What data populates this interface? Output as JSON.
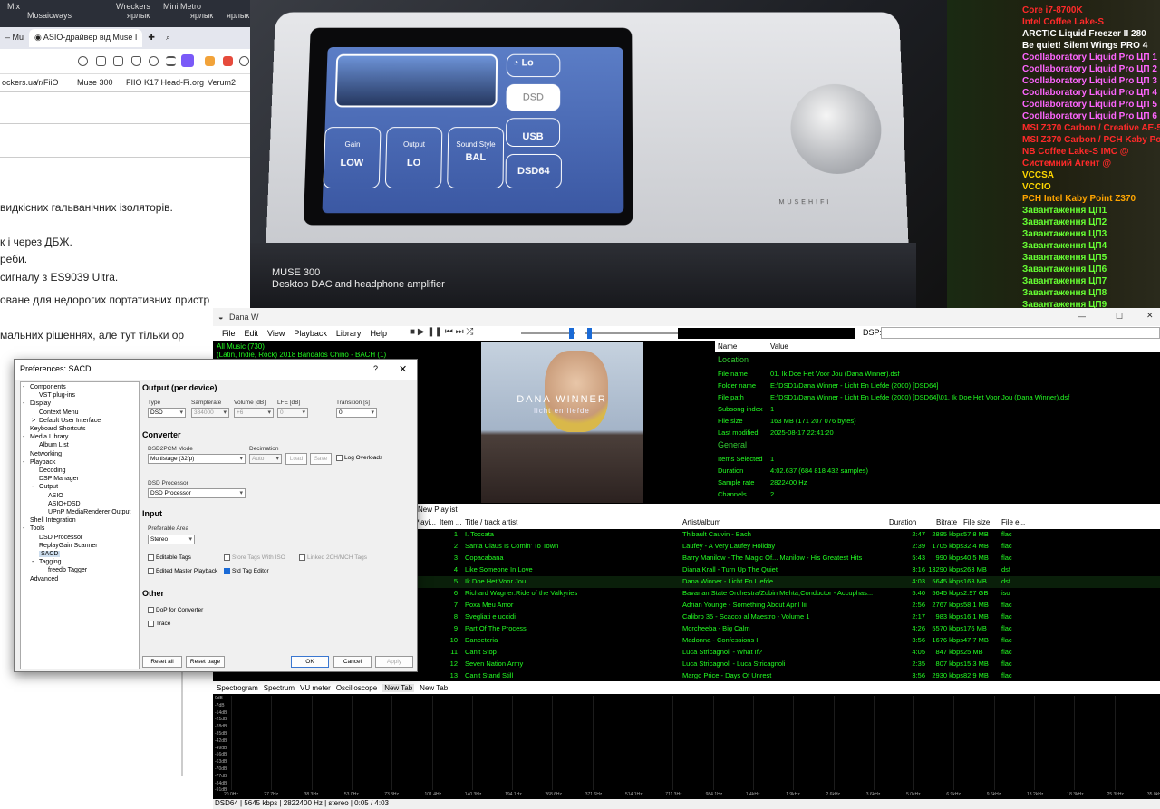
{
  "browser": {
    "desktop_labels": [
      "Mix",
      "Mosaicways",
      "ярлык",
      "Wreckers",
      "Mini Metro",
      "ярлык",
      "ярлык"
    ],
    "tabs": [
      {
        "label": "– Mu"
      },
      {
        "label": "ASIO-драйвер від Muse I"
      }
    ],
    "bookmarks": [
      "ockers.ua",
      "/r/FiiO",
      "Muse 300",
      "FIIO K17 Head-Fi.org",
      "Verum2"
    ],
    "article_lines": [
      "видкісних гальванічних ізоляторів.",
      "к і через ДБЖ.",
      "реби.",
      " сигналу з ES9039 Ultra.",
      "оване для недорогих портативних пристр",
      "мальних рішеннях, але тут тільки ор"
    ]
  },
  "photo": {
    "title": "MUSE 300",
    "subtitle": "Desktop DAC and headphone amplifier",
    "device": {
      "volume_label": "Lo",
      "dsd_label": "DSD",
      "usb_label": "USB",
      "dsd64_label": "DSD64",
      "gain_label": "Gain",
      "gain_value": "LOW",
      "output_label": "Output",
      "output_value": "LO",
      "sound_label": "Sound Style",
      "sound_value": "BAL",
      "brand": "MUSEHIFI"
    }
  },
  "osd": {
    "lines": [
      {
        "text": "Core i7-8700K",
        "color": "#ff2a2a"
      },
      {
        "text": "Intel Coffee Lake-S",
        "color": "#ff2a2a"
      },
      {
        "text": "ARCTIC Liquid Freezer II 280",
        "color": "#ffffff"
      },
      {
        "text": "Be quiet! Silent Wings PRO 4",
        "color": "#ffffff"
      },
      {
        "text": "Coollaboratory Liquid Pro ЦП 1",
        "color": "#ff66ff"
      },
      {
        "text": "Coollaboratory Liquid Pro ЦП 2",
        "color": "#ff66ff"
      },
      {
        "text": "Coollaboratory Liquid Pro ЦП 3",
        "color": "#ff66ff"
      },
      {
        "text": "Coollaboratory Liquid Pro ЦП 4",
        "color": "#ff66ff"
      },
      {
        "text": "Coollaboratory Liquid Pro ЦП 5",
        "color": "#ff66ff"
      },
      {
        "text": "Coollaboratory Liquid Pro ЦП 6",
        "color": "#ff66ff"
      },
      {
        "text": "MSI Z370 Carbon / Creative AE-5",
        "color": "#ff2a2a"
      },
      {
        "text": "MSI Z370 Carbon / PCH Kaby Point",
        "color": "#ff2a2a"
      },
      {
        "text": "NB Coffee Lake-S IMC @",
        "color": "#ff2a2a"
      },
      {
        "text": "Системний Агент @",
        "color": "#ff2a2a"
      },
      {
        "text": "VCCSA",
        "color": "#ffd700"
      },
      {
        "text": "VCCIO",
        "color": "#ffd700"
      },
      {
        "text": "PCH Intel Kaby Point Z370",
        "color": "#ffa500"
      },
      {
        "text": "Завантаження ЦП1",
        "color": "#66ff33"
      },
      {
        "text": "Завантаження ЦП2",
        "color": "#66ff33"
      },
      {
        "text": "Завантаження ЦП3",
        "color": "#66ff33"
      },
      {
        "text": "Завантаження ЦП4",
        "color": "#66ff33"
      },
      {
        "text": "Завантаження ЦП5",
        "color": "#66ff33"
      },
      {
        "text": "Завантаження ЦП6",
        "color": "#66ff33"
      },
      {
        "text": "Завантаження ЦП7",
        "color": "#66ff33"
      },
      {
        "text": "Завантаження ЦП8",
        "color": "#66ff33"
      },
      {
        "text": "Завантаження ЦП9",
        "color": "#66ff33"
      }
    ]
  },
  "foobar": {
    "title": "Dana W",
    "menu": [
      "File",
      "Edit",
      "View",
      "Playback",
      "Library",
      "Help"
    ],
    "dsp_label": "DSP:",
    "library": [
      "All Music (730)",
      "(Latin, Indie, Rock) 2018 Bandalos Chino - BACH (1)"
    ],
    "art": {
      "line1": "DANA WINNER",
      "line2": "licht en liefde"
    },
    "props_headers": {
      "name": "Name",
      "value": "Value"
    },
    "props_location_title": "Location",
    "props_location": [
      {
        "k": "File name",
        "v": "01. Ik Doe Het Voor Jou (Dana Winner).dsf"
      },
      {
        "k": "Folder name",
        "v": "E:\\DSD1\\Dana Winner - Licht En Liefde (2000) [DSD64]"
      },
      {
        "k": "File path",
        "v": "E:\\DSD1\\Dana Winner - Licht En Liefde (2000) [DSD64]\\01. Ik Doe Het Voor Jou (Dana Winner).dsf"
      },
      {
        "k": "Subsong index",
        "v": "1"
      },
      {
        "k": "File size",
        "v": "163 MB (171 207 076 bytes)"
      },
      {
        "k": "Last modified",
        "v": "2025-08-17 22:41:20"
      }
    ],
    "props_general_title": "General",
    "props_general": [
      {
        "k": "Items Selected",
        "v": "1"
      },
      {
        "k": "Duration",
        "v": "4:02.637 (684 818 432 samples)"
      },
      {
        "k": "Sample rate",
        "v": "2822400 Hz"
      },
      {
        "k": "Channels",
        "v": "2"
      }
    ],
    "playlist_tab": "New Playlist",
    "playlist_headers": {
      "playing": "Playi...",
      "item": "Item ...",
      "title": "Title / track artist",
      "artist": "Artist/album",
      "duration": "Duration",
      "bitrate": "Bitrate",
      "size": "File size",
      "ext": "File e..."
    },
    "playlist": [
      {
        "n": "1",
        "title": "I. Toccata",
        "artist": "Thibault Cauvin - Bach",
        "dur": "2:47",
        "br": "2885 kbps",
        "size": "57.8 MB",
        "ext": "flac"
      },
      {
        "n": "2",
        "title": "Santa Claus Is Comin' To Town",
        "artist": "Laufey - A Very Laufey Holiday",
        "dur": "2:39",
        "br": "1705 kbps",
        "size": "32.4 MB",
        "ext": "flac"
      },
      {
        "n": "3",
        "title": "Copacabana",
        "artist": "Barry Manilow - The Magic Of... Manilow -  His Greatest Hits",
        "dur": "5:43",
        "br": "990 kbps",
        "size": "40.5 MB",
        "ext": "flac"
      },
      {
        "n": "4",
        "title": "Like Someone In Love",
        "artist": "Diana Krall - Turn Up The Quiet",
        "dur": "3:16",
        "br": "13290 kbps",
        "size": "263 MB",
        "ext": "dsf"
      },
      {
        "n": "5",
        "title": "Ik Doe Het Voor Jou",
        "artist": "Dana Winner - Licht En Liefde",
        "dur": "4:03",
        "br": "5645 kbps",
        "size": "163 MB",
        "ext": "dsf"
      },
      {
        "n": "6",
        "title": "Richard Wagner:Ride of the Valkyries",
        "artist": "Bavarian State Orchestra/Zubin Mehta,Conductor - Accuphas...",
        "dur": "5:40",
        "br": "5645 kbps",
        "size": "2.97 GB",
        "ext": "iso"
      },
      {
        "n": "7",
        "title": "Poxa Meu Amor",
        "artist": "Adrian Younge - Something About April Iii",
        "dur": "2:56",
        "br": "2767 kbps",
        "size": "58.1 MB",
        "ext": "flac"
      },
      {
        "n": "8",
        "title": "Svegliati e uccidi",
        "artist": "Calibro 35 - Scacco al Maestro - Volume 1",
        "dur": "2:17",
        "br": "983 kbps",
        "size": "16.1 MB",
        "ext": "flac"
      },
      {
        "n": "9",
        "title": "Part Of The Process",
        "artist": "Morcheeba - Big Calm",
        "dur": "4:26",
        "br": "5570 kbps",
        "size": "176 MB",
        "ext": "flac"
      },
      {
        "n": "10",
        "title": "Danceteria",
        "artist": "Madonna - Confessions II",
        "dur": "3:56",
        "br": "1676 kbps",
        "size": "47.7 MB",
        "ext": "flac"
      },
      {
        "n": "11",
        "title": "Can't Stop",
        "artist": "Luca Stricagnoli - What If?",
        "dur": "4:05",
        "br": "847 kbps",
        "size": "25 MB",
        "ext": "flac"
      },
      {
        "n": "12",
        "title": "Seven Nation Army",
        "artist": "Luca Stricagnoli - Luca Stricagnoli",
        "dur": "2:35",
        "br": "807 kbps",
        "size": "15.3 MB",
        "ext": "flac"
      },
      {
        "n": "13",
        "title": "Can't Stand Still",
        "artist": "Margo Price - Days Of Unrest",
        "dur": "3:56",
        "br": "2930 kbps",
        "size": "82.9 MB",
        "ext": "flac"
      }
    ],
    "vis_tabs": [
      "Spectrogram",
      "Spectrum",
      "VU meter",
      "Oscilloscope",
      "New Tab",
      "New Tab"
    ],
    "spectrum_db": [
      "0dB",
      "-7dB",
      "-14dB",
      "-21dB",
      "-28dB",
      "-35dB",
      "-42dB",
      "-49dB",
      "-56dB",
      "-63dB",
      "-70dB",
      "-77dB",
      "-84dB",
      "-91dB"
    ],
    "spectrum_hz": [
      "20.0Hz",
      "27.7Hz",
      "38.3Hz",
      "53.0Hz",
      "73.3Hz",
      "101.4Hz",
      "140.3Hz",
      "194.1Hz",
      "268.6Hz",
      "371.6Hz",
      "514.1Hz",
      "711.3Hz",
      "984.1Hz",
      "1.4kHz",
      "1.9kHz",
      "2.6kHz",
      "3.6kHz",
      "5.0kHz",
      "6.9kHz",
      "9.6kHz",
      "13.2kHz",
      "18.3kHz",
      "25.3kHz",
      "35.0kHz"
    ],
    "status": "DSD64 | 5645 kbps | 2822400 Hz | stereo | 0:05 / 4:03"
  },
  "dialog": {
    "title": "Preferences: SACD",
    "help": "?",
    "close": "✕",
    "tree": [
      {
        "label": "Components",
        "lvl": 0,
        "exp": "-"
      },
      {
        "label": "VST plug-ins",
        "lvl": 1,
        "exp": ""
      },
      {
        "label": "Display",
        "lvl": 0,
        "exp": "-"
      },
      {
        "label": "Context Menu",
        "lvl": 1,
        "exp": ""
      },
      {
        "label": "Default User Interface",
        "lvl": 1,
        "exp": ">"
      },
      {
        "label": "Keyboard Shortcuts",
        "lvl": 0,
        "exp": ""
      },
      {
        "label": "Media Library",
        "lvl": 0,
        "exp": "-"
      },
      {
        "label": "Album List",
        "lvl": 1,
        "exp": ""
      },
      {
        "label": "Networking",
        "lvl": 0,
        "exp": ""
      },
      {
        "label": "Playback",
        "lvl": 0,
        "exp": "-"
      },
      {
        "label": "Decoding",
        "lvl": 1,
        "exp": ""
      },
      {
        "label": "DSP Manager",
        "lvl": 1,
        "exp": ""
      },
      {
        "label": "Output",
        "lvl": 1,
        "exp": "-"
      },
      {
        "label": "ASIO",
        "lvl": 2,
        "exp": ""
      },
      {
        "label": "ASIO+DSD",
        "lvl": 2,
        "exp": ""
      },
      {
        "label": "UPnP MediaRenderer Output",
        "lvl": 2,
        "exp": ""
      },
      {
        "label": "Shell Integration",
        "lvl": 0,
        "exp": ""
      },
      {
        "label": "Tools",
        "lvl": 0,
        "exp": "-"
      },
      {
        "label": "DSD Processor",
        "lvl": 1,
        "exp": ""
      },
      {
        "label": "ReplayGain Scanner",
        "lvl": 1,
        "exp": ""
      },
      {
        "label": "SACD",
        "lvl": 1,
        "exp": "",
        "sel": true
      },
      {
        "label": "Tagging",
        "lvl": 1,
        "exp": "-"
      },
      {
        "label": "freedb Tagger",
        "lvl": 2,
        "exp": ""
      },
      {
        "label": "Advanced",
        "lvl": 0,
        "exp": ""
      }
    ],
    "output_title": "Output (per device)",
    "type_label": "Type",
    "type_value": "DSD",
    "samplerate_label": "Samplerate",
    "samplerate_value": "384000",
    "volume_label": "Volume [dB]",
    "volume_value": "+6",
    "lfe_label": "LFE [dB]",
    "lfe_value": "0",
    "transition_label": "Transition [s]",
    "transition_value": "0",
    "converter_title": "Converter",
    "dsd2pcm_label": "DSD2PCM Mode",
    "dsd2pcm_value": "Multistage (32fp)",
    "decimation_label": "Decimation",
    "decimation_value": "Auto",
    "load_label": "Load",
    "save_label": "Save",
    "log_overloads": "Log Overloads",
    "dsd_processor_label": "DSD Processor",
    "dsd_processor_value": "DSD Processor",
    "input_title": "Input",
    "pref_area_label": "Preferable Area",
    "pref_area_value": "Stereo",
    "editable_tags": "Editable Tags",
    "store_tags_iso": "Store Tags With ISO",
    "linked_tags": "Linked 2CH/MCH Tags",
    "edited_master": "Edited Master Playback",
    "std_tag_editor": "Std Tag Editor",
    "other_title": "Other",
    "dop_converter": "DoP for Converter",
    "trace": "Trace",
    "reset_all": "Reset all",
    "reset_page": "Reset page",
    "ok": "OK",
    "cancel": "Cancel",
    "apply": "Apply"
  }
}
